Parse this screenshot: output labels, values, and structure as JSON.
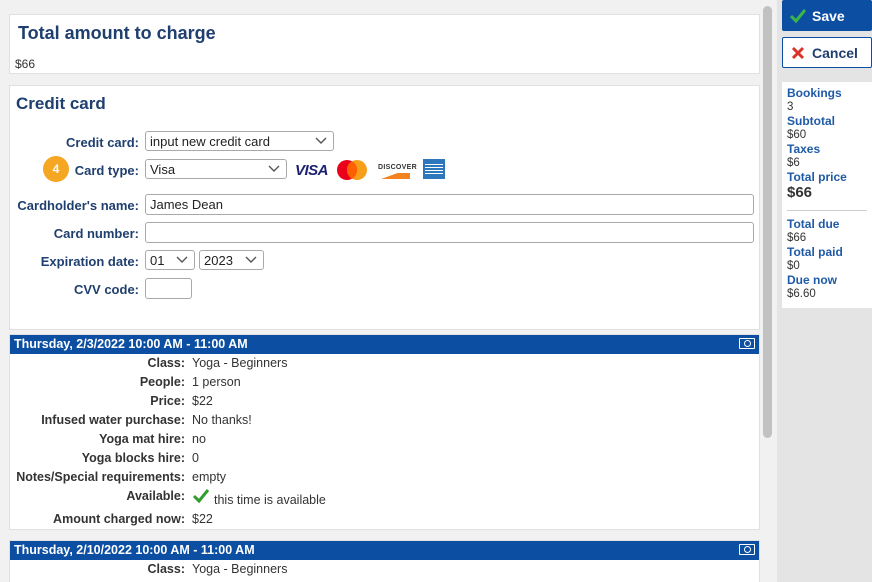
{
  "total": {
    "title": "Total amount to charge",
    "amount": "$66"
  },
  "credit_card": {
    "title": "Credit card",
    "badge": "4",
    "fields": {
      "credit_card_label": "Credit card:",
      "credit_card_value": "input new credit card",
      "card_type_label": "Card type:",
      "card_type_value": "Visa",
      "cardholder_label": "Cardholder's name:",
      "cardholder_value": "James Dean",
      "card_number_label": "Card number:",
      "card_number_value": "",
      "expiration_label": "Expiration date:",
      "exp_month": "01",
      "exp_year": "2023",
      "cvv_label": "CVV code:",
      "cvv_value": ""
    },
    "logos": {
      "visa": "VISA",
      "discover": "DISCOVER"
    }
  },
  "bookings": [
    {
      "header": "Thursday, 2/3/2022 10:00 AM - 11:00 AM",
      "rows": [
        {
          "k": "Class:",
          "v": "Yoga - Beginners"
        },
        {
          "k": "People:",
          "v": "1 person"
        },
        {
          "k": "Price:",
          "v": "$22"
        },
        {
          "k": "Infused water purchase:",
          "v": "No thanks!"
        },
        {
          "k": "Yoga mat hire:",
          "v": "no"
        },
        {
          "k": "Yoga blocks hire:",
          "v": "0"
        },
        {
          "k": "Notes/Special requirements:",
          "v": "empty"
        },
        {
          "k": "Available:",
          "v": "this time is available"
        },
        {
          "k": "Amount charged now:",
          "v": "$22"
        }
      ]
    },
    {
      "header": "Thursday, 2/10/2022 10:00 AM - 11:00 AM",
      "rows": [
        {
          "k": "Class:",
          "v": "Yoga - Beginners"
        }
      ]
    }
  ],
  "sidebar": {
    "save_label": "Save",
    "cancel_label": "Cancel",
    "summary": {
      "bookings_label": "Bookings",
      "bookings_value": "3",
      "subtotal_label": "Subtotal",
      "subtotal_value": "$60",
      "taxes_label": "Taxes",
      "taxes_value": "$6",
      "total_price_label": "Total price",
      "total_price_value": "$66",
      "total_due_label": "Total due",
      "total_due_value": "$66",
      "total_paid_label": "Total paid",
      "total_paid_value": "$0",
      "due_now_label": "Due now",
      "due_now_value": "$6.60"
    }
  },
  "colors": {
    "accent": "#0b4ea2",
    "heading": "#1f3f6f",
    "badge": "#f5a623",
    "success": "#2e9e2e",
    "danger": "#d9342b"
  }
}
